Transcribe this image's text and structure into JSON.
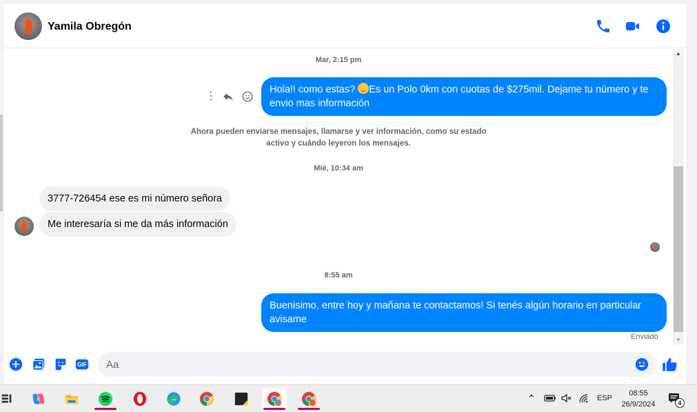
{
  "header": {
    "contact_name": "Yamila Obregón"
  },
  "conversation": {
    "timestamps": [
      "Mar, 2:15 pm",
      "Mié, 10:34 am",
      "8:55 am"
    ],
    "message_out_1_text": "Hola!! como estas? ",
    "message_out_1_text_after_emoji": "Es un Polo 0km con cuotas de $275mil. Dejame tu número y te envio mas información",
    "notice_line_1": "Ahora pueden enviarse mensajes, llamarse y ver información, como su estado",
    "notice_line_2": "activo y cuándo leyeron los mensajes.",
    "message_in_1": "3777-726454 ese es mi número señora",
    "message_in_2": "Me interesaría si me da más información",
    "message_out_2": "Buenisimo, entre hoy y mañana te contactamos! Si tenés algún horario en particular avisame",
    "sent_status": "Enviado"
  },
  "composer": {
    "placeholder": "Aa",
    "gif_label": "GIF"
  },
  "taskbar": {
    "language": "ESP",
    "time": "08:55",
    "date": "26/9/2024",
    "notification_count": "4"
  },
  "colors": {
    "accent": "#0084ff",
    "incoming_bubble": "#f0f0f0",
    "icon_blue": "#0866ff"
  }
}
